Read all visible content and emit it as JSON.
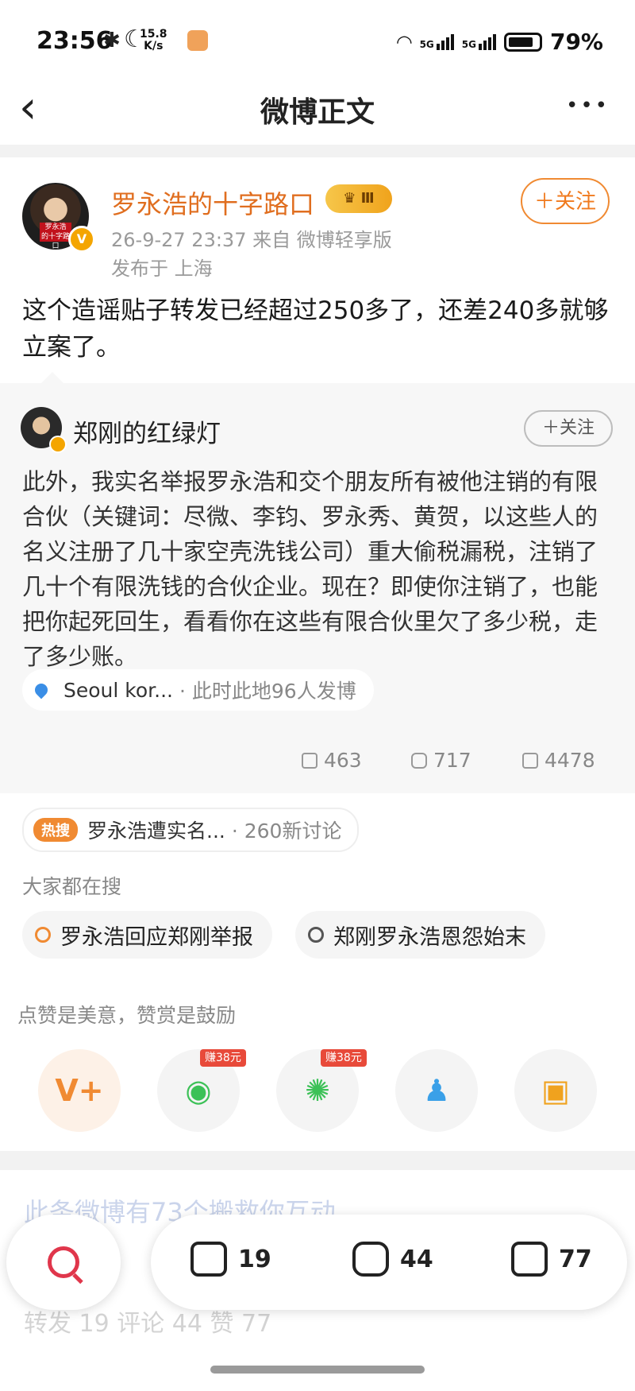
{
  "status_bar": {
    "time": "23:56",
    "speed_top": "15.8",
    "speed_bottom": "K/s",
    "net1": "5G",
    "net2": "5G",
    "battery": "79%"
  },
  "nav": {
    "title": "微博正文",
    "more": "•••",
    "back": "‹"
  },
  "author": {
    "name": "罗永浩的十字路口",
    "level": "♛ Ⅲ",
    "time_source": "26-9-27 23:37   来自 微博轻享版",
    "location": "发布于 上海",
    "follow": "＋关注",
    "vbadge": "V"
  },
  "post": {
    "text": "这个造谣贴子转发已经超过250多了，还差240多就够立案了。"
  },
  "retweet": {
    "name": "郑刚的红绿灯",
    "follow": "＋关注",
    "text": "此外，我实名举报罗永浩和交个朋友所有被他注销的有限合伙（关键词：尽微、李钧、罗永秀、黄贺，以这些人的名义注册了几十家空壳洗钱公司）重大偷税漏税，注销了几十个有限洗钱的合伙企业。现在？即使你注销了，也能把你起死回生，看看你在这些有限合伙里欠了多少税，走了多少账。",
    "location": "Seoul kor...",
    "location_sub": "· 此时此地96人发博",
    "reposts": "463",
    "comments": "717",
    "likes": "4478"
  },
  "hot": {
    "badge": "热搜",
    "topic": "罗永浩遭实名...",
    "sub": "· 260新讨论"
  },
  "searching": {
    "label": "大家都在搜",
    "chips": [
      "罗永浩回应郑刚举报",
      "郑刚罗永浩恩怨始末"
    ]
  },
  "praise": {
    "label": "点赞是美意，赞赏是鼓励",
    "earn1": "赚38元",
    "earn2": "赚38元",
    "reward_icon": "V+"
  },
  "background": {
    "faded_top": "此条微博有73个搬救你互动",
    "faded_bottom": "转发 19    评论 44                                     赞 77"
  },
  "bottom_bar": {
    "repost": "19",
    "comment": "44",
    "like": "77"
  },
  "colors": {
    "accent": "#f07a1e",
    "name": "#e06e1f",
    "hot_badge": "#f08a32",
    "search": "#e0364b"
  }
}
